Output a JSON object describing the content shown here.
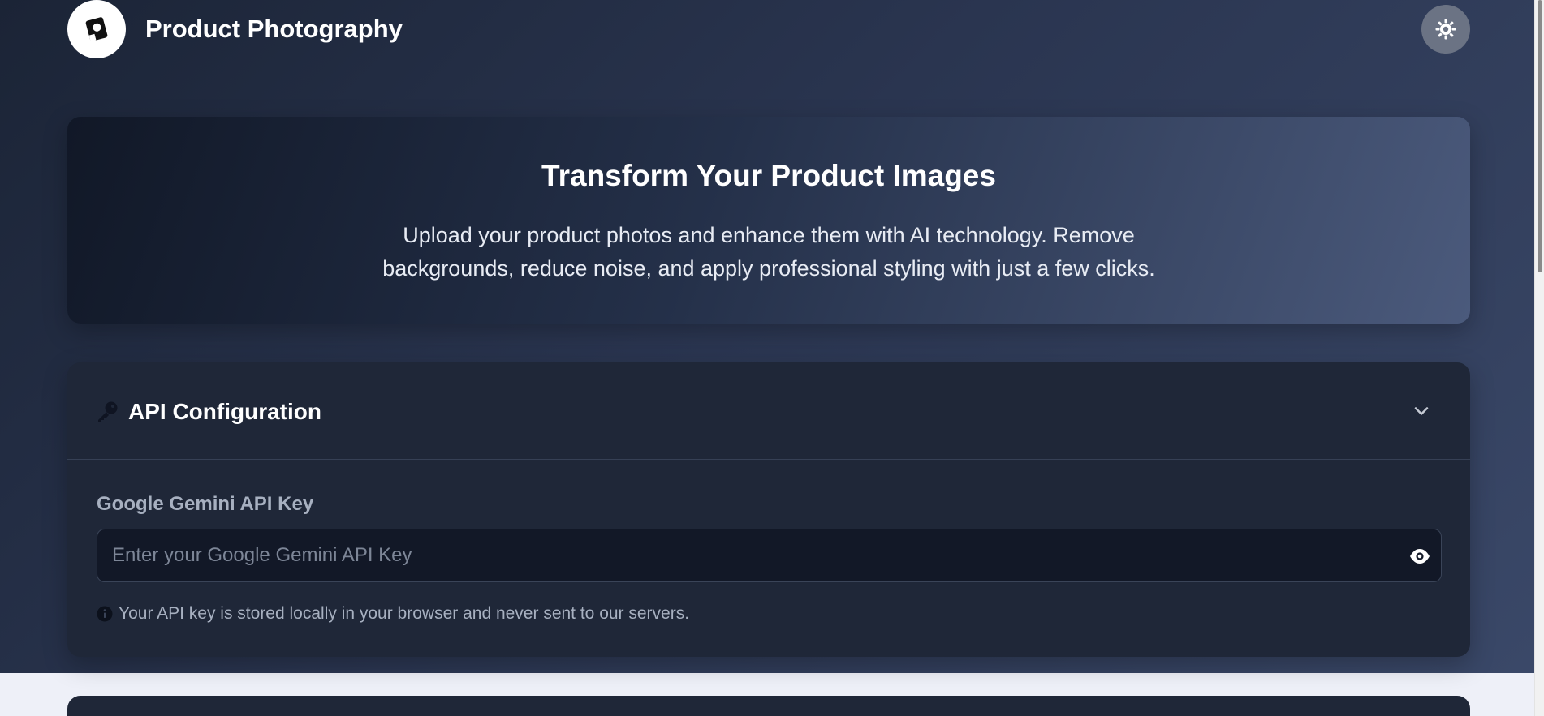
{
  "header": {
    "app_title": "Product Photography",
    "logo_icon": "camera-logo-icon",
    "theme_toggle_icon": "sun-icon"
  },
  "hero": {
    "title": "Transform Your Product Images",
    "description": "Upload your product photos and enhance them with AI technology. Remove backgrounds, reduce noise, and apply professional styling with just a few clicks."
  },
  "api_config": {
    "title": "API Configuration",
    "title_icon": "key-icon",
    "collapse_icon": "chevron-down-icon",
    "field_label": "Google Gemini API Key",
    "input_value": "",
    "input_placeholder": "Enter your Google Gemini API Key",
    "visibility_icon": "eye-icon",
    "note_icon": "info-icon",
    "note": "Your API key is stored locally in your browser and never sent to our servers."
  },
  "colors": {
    "page_gradient_start": "#1b2436",
    "page_gradient_end": "#3a4868",
    "card_bg": "#1f2738",
    "input_bg": "#121827",
    "muted_text": "#a7b0c0",
    "white": "#ffffff"
  }
}
